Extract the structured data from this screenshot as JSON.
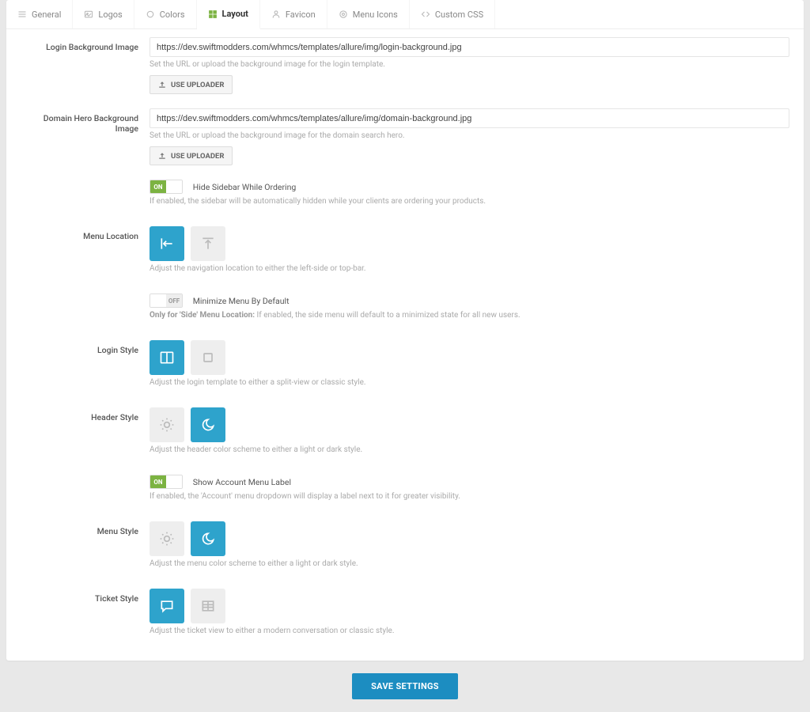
{
  "tabs": {
    "general": "General",
    "logos": "Logos",
    "colors": "Colors",
    "layout": "Layout",
    "favicon": "Favicon",
    "menu_icons": "Menu Icons",
    "custom_css": "Custom CSS"
  },
  "login_bg": {
    "label": "Login Background Image",
    "value": "https://dev.swiftmodders.com/whmcs/templates/allure/img/login-background.jpg",
    "help": "Set the URL or upload the background image for the login template.",
    "uploader": "USE UPLOADER"
  },
  "domain_bg": {
    "label": "Domain Hero Background Image",
    "value": "https://dev.swiftmodders.com/whmcs/templates/allure/img/domain-background.jpg",
    "help": "Set the URL or upload the background image for the domain search hero.",
    "uploader": "USE UPLOADER"
  },
  "hide_sidebar": {
    "on": "ON",
    "label": "Hide Sidebar While Ordering",
    "help": "If enabled, the sidebar will be automatically hidden while your clients are ordering your products."
  },
  "menu_location": {
    "label": "Menu Location",
    "help": "Adjust the navigation location to either the left-side or top-bar."
  },
  "minimize": {
    "off": "OFF",
    "label": "Minimize Menu By Default",
    "help_bold": "Only for 'Side' Menu Location:",
    "help_rest": " If enabled, the side menu will default to a minimized state for all new users."
  },
  "login_style": {
    "label": "Login Style",
    "help": "Adjust the login template to either a split-view or classic style."
  },
  "header_style": {
    "label": "Header Style",
    "help": "Adjust the header color scheme to either a light or dark style."
  },
  "show_acct": {
    "on": "ON",
    "label": "Show Account Menu Label",
    "help": "If enabled, the 'Account' menu dropdown will display a label next to it for greater visibility."
  },
  "menu_style": {
    "label": "Menu Style",
    "help": "Adjust the menu color scheme to either a light or dark style."
  },
  "ticket_style": {
    "label": "Ticket Style",
    "help": "Adjust the ticket view to either a modern conversation or classic style."
  },
  "save": "SAVE SETTINGS"
}
